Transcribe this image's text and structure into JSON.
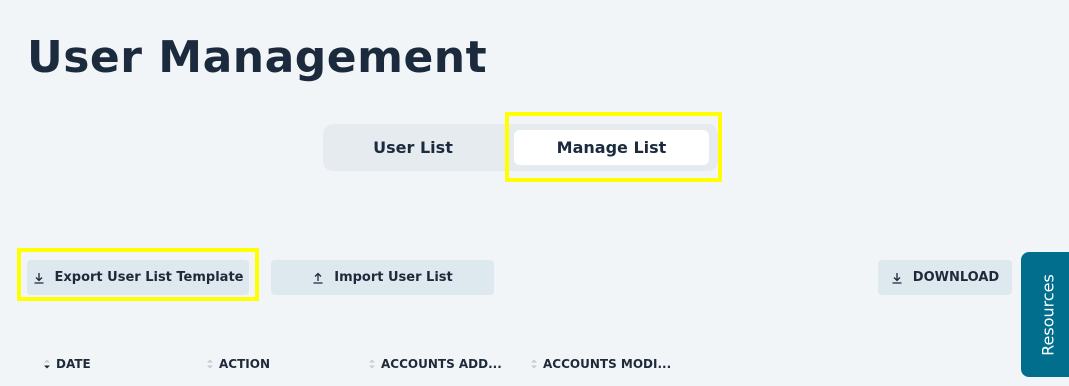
{
  "page": {
    "title": "User Management"
  },
  "tabs": [
    {
      "label": "User List",
      "active": false
    },
    {
      "label": "Manage List",
      "active": true
    }
  ],
  "actions": {
    "export_label": "Export User List Template",
    "import_label": "Import User List",
    "download_label": "DOWNLOAD"
  },
  "resources": {
    "label": "Resources"
  },
  "table": {
    "columns": [
      {
        "label": "DATE",
        "sort": "descending"
      },
      {
        "label": "ACTION",
        "sort": "none"
      },
      {
        "label": "ACCOUNTS ADD...",
        "sort": "none"
      },
      {
        "label": "ACCOUNTS MODI...",
        "sort": "none"
      }
    ]
  },
  "icons": {
    "download": "download-icon",
    "upload": "upload-icon",
    "sort": "sort-icon"
  },
  "colors": {
    "highlight": "#ffff00",
    "resources_tab": "#006e8c",
    "button_bg": "#dde8ef",
    "background": "#f2f5f8"
  }
}
